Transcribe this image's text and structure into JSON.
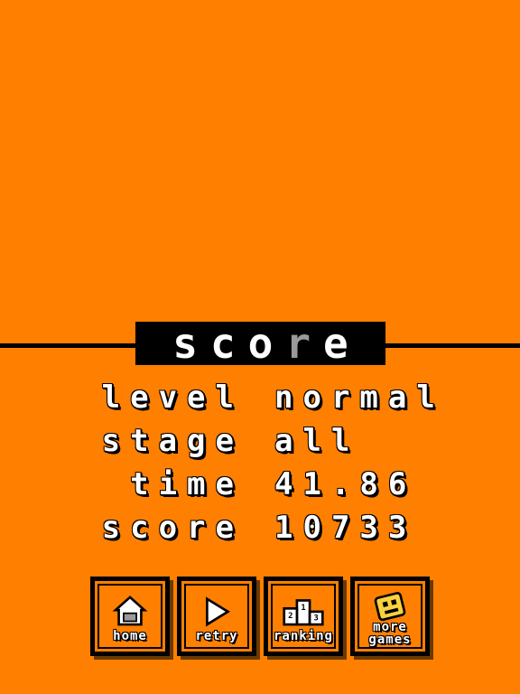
{
  "title": {
    "part1": "sco",
    "part2": "r",
    "part3": "e"
  },
  "stats": [
    {
      "label": "level",
      "value": "normal"
    },
    {
      "label": "stage",
      "value": "all"
    },
    {
      "label": "time",
      "value": "41.86"
    },
    {
      "label": "score",
      "value": "10733"
    }
  ],
  "buttons": {
    "home": {
      "label": "home",
      "icon": "home-icon"
    },
    "retry": {
      "label": "retry",
      "icon": "play-icon"
    },
    "ranking": {
      "label": "ranking",
      "icon": "podium-icon",
      "podium": [
        "2",
        "1",
        "3"
      ]
    },
    "more_games": {
      "label_line1": "more",
      "label_line2": "games",
      "icon": "block-face-icon"
    }
  },
  "colors": {
    "background": "#FF7F00",
    "title_box": "#000000",
    "text": "#FFFFFF",
    "accent_grey": "#9A9A9A",
    "icon_yellow": "#F7D23E"
  }
}
